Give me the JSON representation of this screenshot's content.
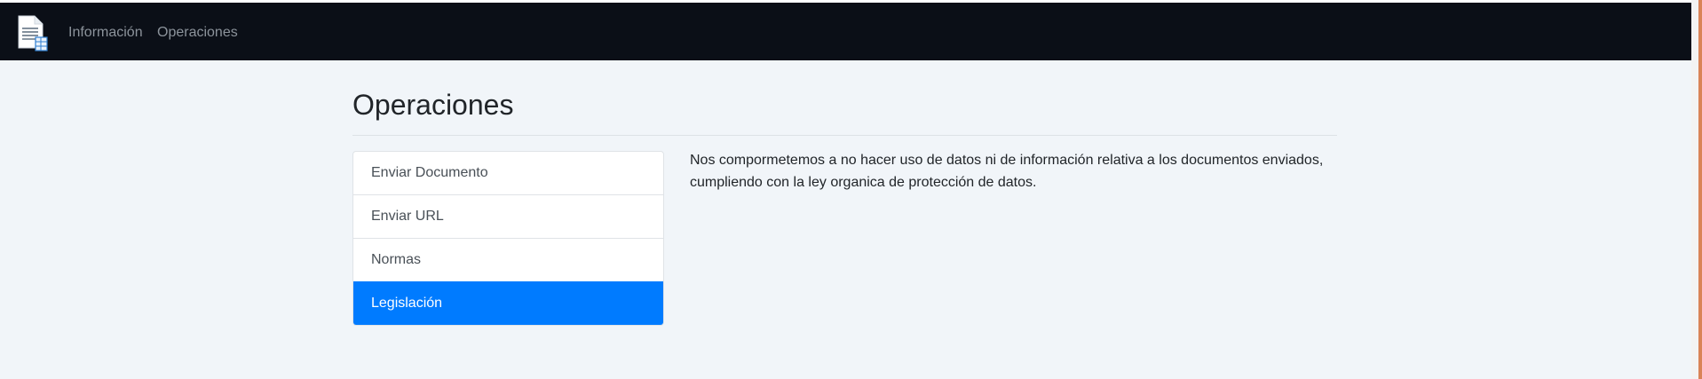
{
  "navbar": {
    "brand_icon": "document-icon",
    "links": [
      {
        "label": "Información"
      },
      {
        "label": "Operaciones"
      }
    ]
  },
  "page": {
    "title": "Operaciones"
  },
  "menu": {
    "items": [
      {
        "label": "Enviar Documento",
        "active": false
      },
      {
        "label": "Enviar URL",
        "active": false
      },
      {
        "label": "Normas",
        "active": false
      },
      {
        "label": "Legislación",
        "active": true
      }
    ]
  },
  "content": {
    "text": "Nos compormetemos a no hacer uso de datos ni de información relativa a los documentos enviados, cumpliendo con la ley organica de protección de datos."
  },
  "colors": {
    "navbar_bg": "#0b0f17",
    "active_item": "#007bff",
    "page_bg": "#f1f5f9"
  }
}
